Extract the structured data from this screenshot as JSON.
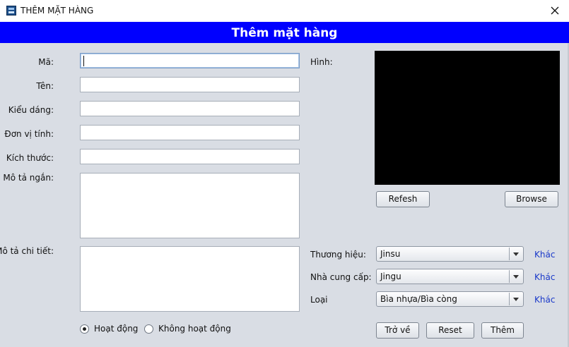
{
  "window": {
    "title": "THÊM MẶT HÀNG"
  },
  "banner": {
    "title": "Thêm mặt hàng"
  },
  "form": {
    "ma_label": "Mã:",
    "ma_value": "",
    "ten_label": "Tên:",
    "ten_value": "",
    "kieu_dang_label": "Kiểu dáng:",
    "kieu_dang_value": "",
    "don_vi_tinh_label": "Đơn vị tính:",
    "don_vi_tinh_value": "",
    "kich_thuoc_label": "Kích thước:",
    "kich_thuoc_value": "",
    "mo_ta_ngan_label": "Mô tả ngắn:",
    "mo_ta_ngan_value": "",
    "mo_ta_chi_tiet_label": "Mô tả chi tiết:",
    "mo_ta_chi_tiet_value": ""
  },
  "image": {
    "label": "Hình:",
    "background_color": "#000000",
    "refresh_label": "Refesh",
    "browse_label": "Browse"
  },
  "selects": {
    "thuong_hieu_label": "Thương hiệu:",
    "thuong_hieu_value": "Jinsu",
    "nha_cung_cap_label": "Nhà cung cấp:",
    "nha_cung_cap_value": "Jingu",
    "loai_label": "Loại",
    "loai_value": "Bìa nhựa/Bìa còng",
    "other_link": "Khác"
  },
  "status": {
    "active_label": "Hoạt động",
    "inactive_label": "Không hoạt động",
    "selected": "active"
  },
  "actions": {
    "back_label": "Trở về",
    "reset_label": "Reset",
    "add_label": "Thêm"
  },
  "colors": {
    "banner": "#0000ff",
    "link": "#1a39c9",
    "window_background": "#d9dde4"
  }
}
